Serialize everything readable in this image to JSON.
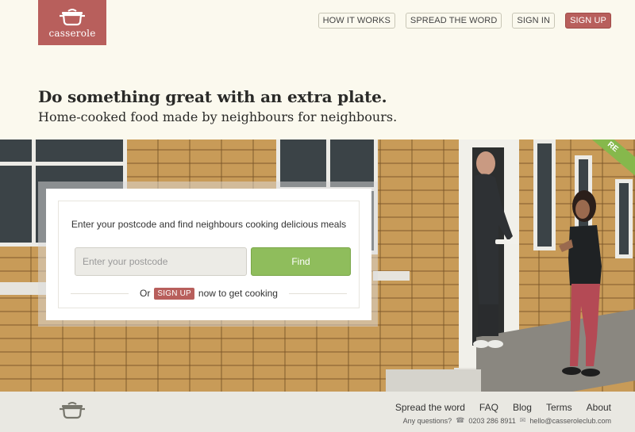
{
  "brand": {
    "name": "casserole",
    "color": "#b85f5c"
  },
  "nav": {
    "how_it_works": "HOW IT WORKS",
    "spread_the_word": "SPREAD THE WORD",
    "sign_in": "SIGN IN",
    "sign_up": "SIGN UP"
  },
  "hero": {
    "headline": "Do something great with an extra plate.",
    "subline": "Home-cooked food made by neighbours for neighbours.",
    "ribbon": "RE"
  },
  "search": {
    "prompt": "Enter your postcode and find neighbours cooking delicious meals",
    "placeholder": "Enter your postcode",
    "value": "",
    "find_label": "Find",
    "or_label": "Or",
    "signup_label": "SIGN UP",
    "signup_suffix": "now to get cooking",
    "accent_green": "#8fbd5c"
  },
  "footer": {
    "links": [
      "Spread the word",
      "FAQ",
      "Blog",
      "Terms",
      "About"
    ],
    "questions": "Any questions?",
    "phone": "0203 286 8911",
    "email": "hello@casseroleclub.com",
    "phone_icon": "phone-icon",
    "email_icon": "envelope-icon"
  }
}
